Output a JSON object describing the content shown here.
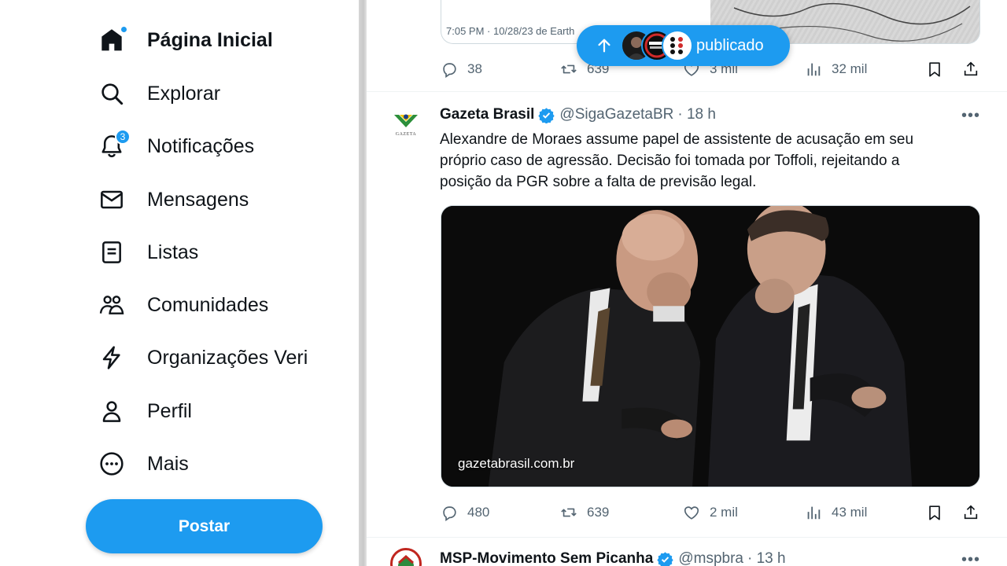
{
  "sidebar": {
    "items": [
      {
        "label": "Página Inicial",
        "icon": "home-icon"
      },
      {
        "label": "Explorar",
        "icon": "search-icon"
      },
      {
        "label": "Notificações",
        "icon": "bell-icon",
        "badge": "3"
      },
      {
        "label": "Mensagens",
        "icon": "envelope-icon"
      },
      {
        "label": "Listas",
        "icon": "list-icon"
      },
      {
        "label": "Comunidades",
        "icon": "people-icon"
      },
      {
        "label": "Organizações Veri",
        "icon": "lightning-icon"
      },
      {
        "label": "Perfil",
        "icon": "person-icon"
      },
      {
        "label": "Mais",
        "icon": "more-circle-icon"
      }
    ],
    "post_button": "Postar"
  },
  "toast": {
    "label": "publicado"
  },
  "previous_tweet": {
    "timestamp": "7:05 PM · 10/28/23 de Earth",
    "stats": {
      "replies": "38",
      "retweets": "639",
      "likes": "3 mil",
      "views": "32 mil"
    }
  },
  "tweet": {
    "name": "Gazeta Brasil",
    "handle": "@SigaGazetaBR",
    "time": "· 18 h",
    "text_lines": [
      "Alexandre de Moraes assume papel de assistente de acusação em seu",
      "próprio caso de agressão. Decisão foi tomada por Toffoli,  rejeitando a",
      "posição da PGR sobre a falta de previsão legal."
    ],
    "media_caption": "gazetabrasil.com.br",
    "avatar_text": "GAZETA",
    "stats": {
      "replies": "480",
      "retweets": "639",
      "likes": "2 mil",
      "views": "43 mil"
    }
  },
  "next_tweet": {
    "name": "MSP-Movimento Sem Picanha",
    "handle": "@mspbra",
    "time": "· 13 h"
  },
  "colors": {
    "accent": "#1d9bf0",
    "text": "#0f1419",
    "secondary": "#536471"
  }
}
